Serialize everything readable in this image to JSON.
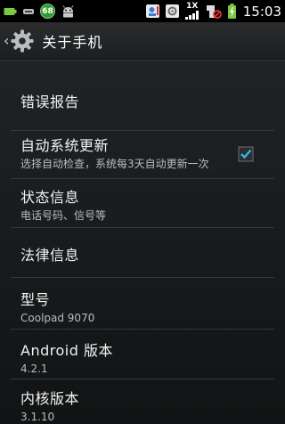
{
  "status_bar": {
    "clock": "15:03",
    "notification_badge": "68",
    "network_label": "1X",
    "icons": [
      "battery-small-icon",
      "usb-icon",
      "security-badge-icon",
      "android-icon",
      "contacts-icon",
      "photo-icon",
      "signal-icon",
      "no-sim-icon",
      "battery-charging-icon"
    ]
  },
  "action_bar": {
    "title": "关于手机",
    "back_glyph": "‹"
  },
  "items": [
    {
      "title": "错误报告"
    },
    {
      "title": "自动系统更新",
      "summary": "选择自动检查，系统每3天自动更新一次",
      "checked": true
    },
    {
      "title": "状态信息",
      "summary": "电话号码、信号等"
    },
    {
      "title": "法律信息"
    },
    {
      "title": "型号",
      "summary": "Coolpad 9070"
    },
    {
      "title": "Android 版本",
      "summary": "4.2.1"
    },
    {
      "title": "内核版本",
      "summary": "3.1.10"
    }
  ],
  "colors": {
    "accent": "#33b5e5",
    "background": "#1b1d1f",
    "divider": "#34383b"
  }
}
